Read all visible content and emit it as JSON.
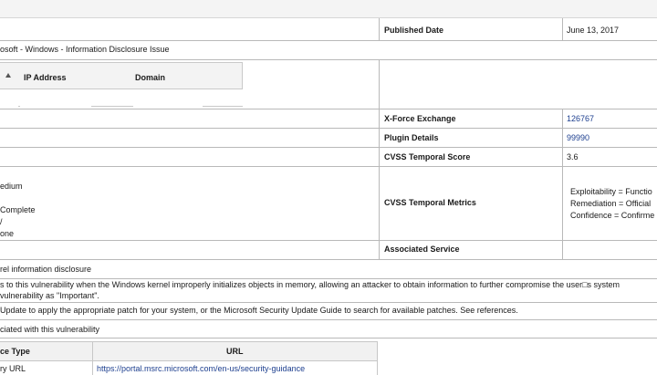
{
  "left_rows": {
    "vuln_name": "osoft - Windows - Information Disclosure Issue",
    "severity_lines": [
      "edium",
      "",
      "Complete",
      "/",
      "one"
    ],
    "vuln_title": "rel information disclosure",
    "description_line1": "s to this vulnerability when the Windows kernel improperly initializes objects in memory, allowing an attacker to obtain information to further compromise the user□s system",
    "description_line2": "vulnerability as \"Important\".",
    "solution": "Update to apply the appropriate patch for your system, or the Microsoft Security Update Guide to search for available patches. See references.",
    "references_intro": "ciated with this vulnerability"
  },
  "hosts_table": {
    "columns": [
      "IP Address",
      "Domain"
    ]
  },
  "details": {
    "published_label": "Published Date",
    "published_value": "June 13, 2017",
    "xforce_label": "X-Force Exchange",
    "xforce_value": "126767",
    "plugin_label": "Plugin Details",
    "plugin_value": "99990",
    "cvss_score_label": "CVSS Temporal Score",
    "cvss_score_value": "3.6",
    "cvss_metrics_label": "CVSS Temporal Metrics",
    "cvss_metrics_lines": [
      "Exploitability = Functio",
      "Remediation = Official",
      "Confidence = Confirme"
    ],
    "service_label": "Associated Service"
  },
  "references_table": {
    "col_type": "ce Type",
    "col_url": "URL",
    "row_type": "ry URL",
    "row_url": "https://portal.msrc.microsoft.com/en-us/security-guidance"
  }
}
